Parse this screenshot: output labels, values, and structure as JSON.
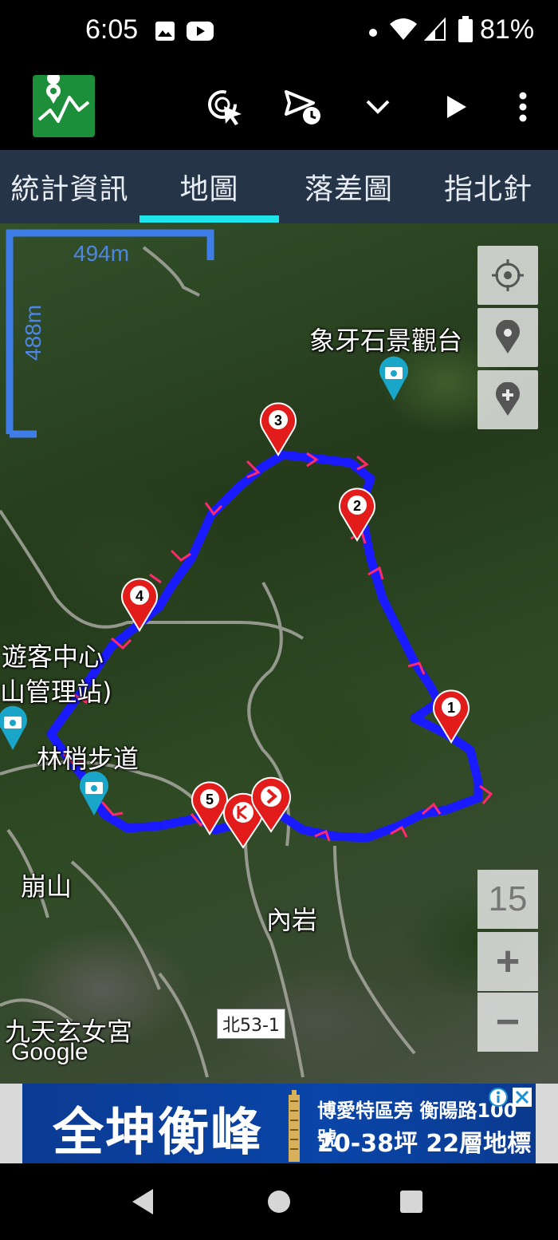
{
  "status_bar": {
    "time": "6:05",
    "battery": "81%",
    "icons": [
      "gallery-icon",
      "youtube-icon",
      "dot-icon",
      "wifi-icon",
      "signal-icon",
      "battery-icon"
    ]
  },
  "toolbar": {
    "app_icon": "map-chart-app-icon",
    "buttons": [
      "target-cursor-icon",
      "send-clock-icon",
      "chevron-down-icon",
      "play-icon",
      "more-vertical-icon"
    ]
  },
  "tabs": [
    {
      "label": "統計資訊"
    },
    {
      "label": "地圖",
      "selected": true
    },
    {
      "label": "落差圖"
    },
    {
      "label": "指北針"
    }
  ],
  "map": {
    "scale_horizontal": "494m",
    "scale_vertical": "488m",
    "zoom_level": "15",
    "zoom_in": "+",
    "zoom_out": "−",
    "google": "Google",
    "road_sign": "北53-1",
    "labels": {
      "elephant_rock": "象牙石景觀台",
      "visitor_center_1": "遊客中心",
      "visitor_center_2": "山管理站)",
      "linshao_trail": "林梢步道",
      "bengshan": "崩山",
      "neiyan": "內岩",
      "jiutian": "九天玄女宮"
    },
    "markers": [
      "1",
      "2",
      "3",
      "4",
      "5"
    ],
    "colors": {
      "route": "#1a1aff",
      "arrow": "#ff2a6d",
      "marker": "#e21b1b"
    }
  },
  "ad": {
    "title": "全坤衡峰",
    "line1": "博愛特區旁 衡陽路100號",
    "line2": "20-38坪 22層地標"
  }
}
